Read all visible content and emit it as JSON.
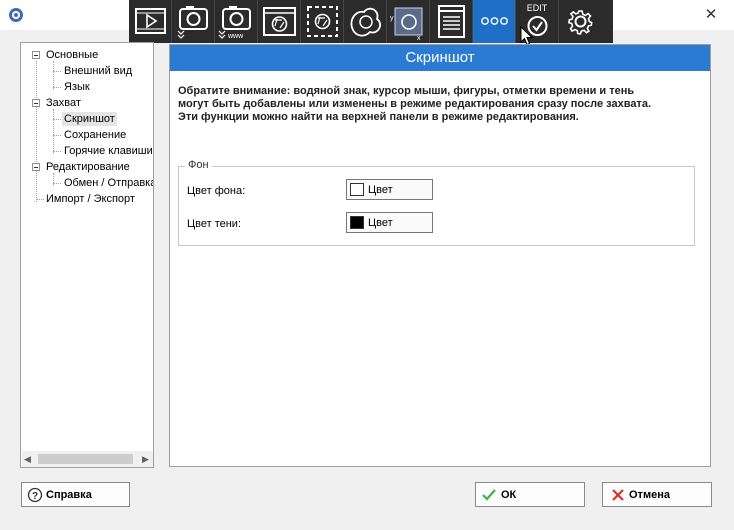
{
  "window": {
    "close_glyph": "✕"
  },
  "toolbar": {
    "edit_label": "EDIT",
    "buttons": [
      {
        "name": "record-video-icon"
      },
      {
        "name": "screenshot-menu-icon"
      },
      {
        "name": "web-screenshot-icon"
      },
      {
        "name": "window-capture-icon"
      },
      {
        "name": "region-capture-icon"
      },
      {
        "name": "freeform-capture-icon"
      },
      {
        "name": "fixed-region-capture-icon"
      },
      {
        "name": "scrolling-capture-icon"
      },
      {
        "name": "more-icon"
      },
      {
        "name": "edit-check-icon"
      },
      {
        "name": "gear-icon"
      }
    ]
  },
  "tree": {
    "items": [
      {
        "label": "Основные"
      },
      {
        "label": "Внешний вид"
      },
      {
        "label": "Язык"
      },
      {
        "label": "Захват"
      },
      {
        "label": "Скриншот"
      },
      {
        "label": "Сохранение"
      },
      {
        "label": "Горячие клавиши"
      },
      {
        "label": "Редактирование"
      },
      {
        "label": "Обмен / Отправка"
      },
      {
        "label": "Импорт / Экспорт"
      }
    ],
    "scroll_left": "◀",
    "scroll_right": "▶"
  },
  "page": {
    "title": "Скриншот",
    "notice_line1": "Обратите внимание: водяной знак, курсор мыши, фигуры, отметки времени и тень",
    "notice_line2": "могут быть добавлены или изменены в режиме редактирования сразу после захвата.",
    "notice_line3": "Эти функции можно найти на верхней панели в режиме редактирования.",
    "group_title": "Фон",
    "rows": [
      {
        "label": "Цвет фона:",
        "button_label": "Цвет",
        "color": "#ffffff"
      },
      {
        "label": "Цвет тени:",
        "button_label": "Цвет",
        "color": "#000000"
      }
    ]
  },
  "buttons": {
    "help": "Справка",
    "help_icon_glyph": "?",
    "ok": "ОК",
    "cancel": "Отмена"
  },
  "colors": {
    "accent": "#2b7bd4",
    "toolbar_bg": "#2b2b2b",
    "toolbar_active": "#1f6fc7",
    "ok_green": "#3cb34a",
    "cancel_red": "#d9312a"
  }
}
